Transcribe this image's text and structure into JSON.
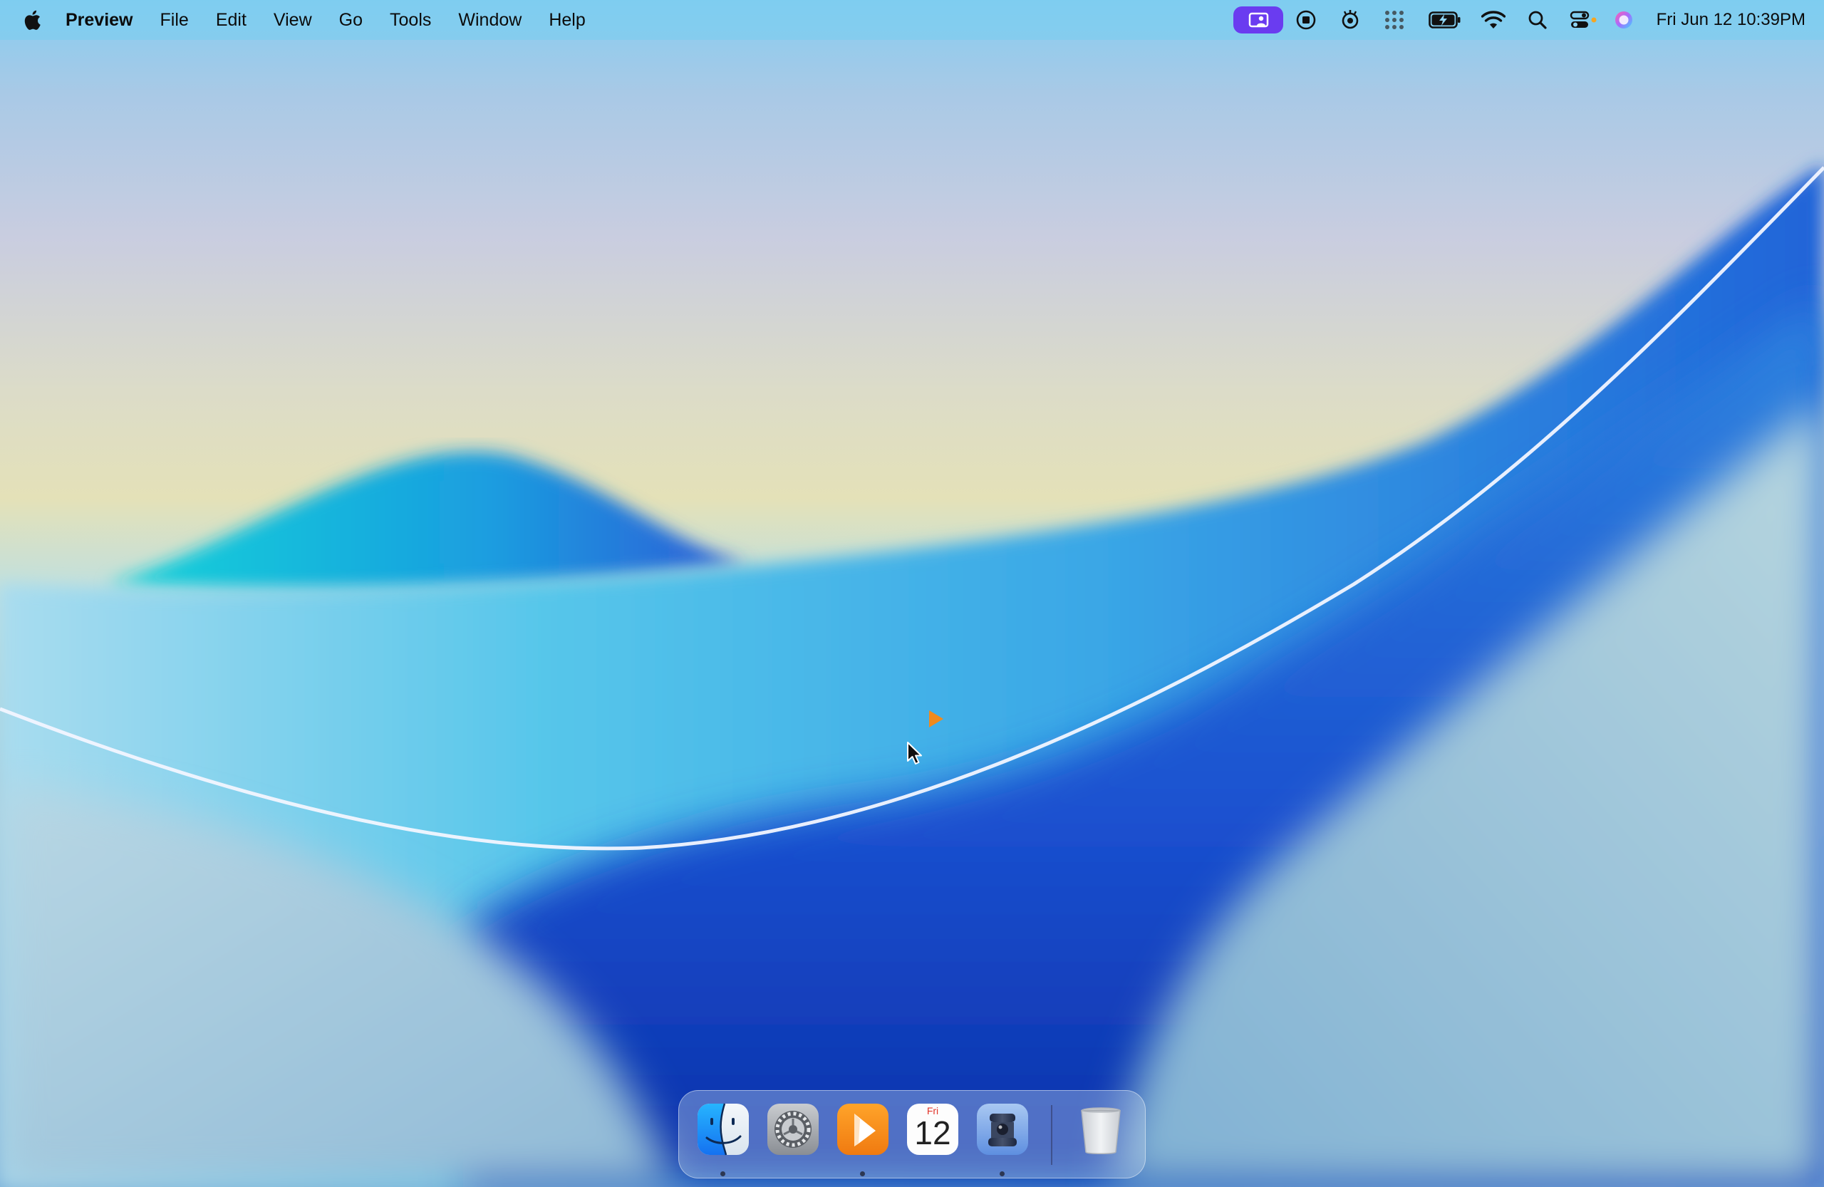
{
  "menubar": {
    "app_name": "Preview",
    "menus": [
      "File",
      "Edit",
      "View",
      "Go",
      "Tools",
      "Window",
      "Help"
    ],
    "clock": "Fri Jun 12  10:39PM"
  },
  "dock": {
    "apps": [
      {
        "name": "Finder",
        "running": true
      },
      {
        "name": "System Settings",
        "running": false
      },
      {
        "name": "Presentation app",
        "running": true
      },
      {
        "name": "Calendar",
        "running": false,
        "day": "Fri",
        "date": "12"
      },
      {
        "name": "Preview app",
        "running": true
      },
      {
        "name": "Trash",
        "running": false
      }
    ]
  },
  "colors": {
    "screen_sharing_badge": "#6a3cf0",
    "cursor_marker": "#f08a1c"
  }
}
